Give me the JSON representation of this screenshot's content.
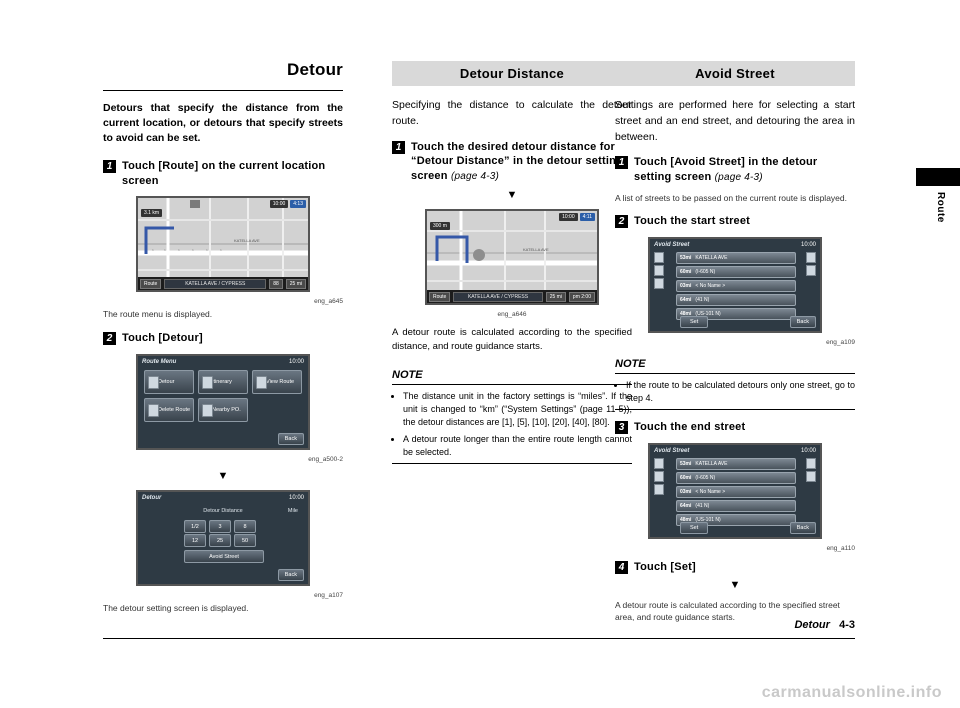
{
  "page": {
    "footer_title": "Detour",
    "footer_page": "4-3",
    "side_tab_label": "Route",
    "watermark": "carmanualsonline.info"
  },
  "col1": {
    "title": "Detour",
    "lead": "Detours that specify the distance from the current location, or detours that specify streets to avoid can be set.",
    "step1_num": "1",
    "step1_text": "Touch [Route] on the current location screen",
    "fig1_caption": "eng_a645",
    "after_fig1": "The route menu is displayed.",
    "step2_num": "2",
    "step2_text": "Touch [Detour]",
    "fig2_caption": "eng_a500-2",
    "fig3_caption": "eng_a107",
    "after_fig3": "The detour setting screen is displayed.",
    "map_shot": {
      "zoom_label": "3.1 km",
      "clock": "10:00",
      "eta_label": "4:13",
      "street": "KATELLA AVE / CYPRESS",
      "btn_route": "Route",
      "dist_value": "88",
      "dist_unit": "25 mi"
    },
    "route_menu": {
      "title": "Route Menu",
      "clock": "10:00",
      "buttons": [
        "Detour",
        "Itinerary",
        "View Route",
        "Delete Route",
        "Nearby PO."
      ],
      "back": "Back"
    },
    "detour_screen": {
      "title": "Detour",
      "clock": "10:00",
      "heading": "Detour Distance",
      "unit": "Mile",
      "row1": [
        "1/2",
        "3",
        "8"
      ],
      "row2": [
        "12",
        "25",
        "50"
      ],
      "avoid_street": "Avoid Street",
      "back": "Back"
    }
  },
  "col2": {
    "band": "Detour Distance",
    "intro": "Specifying the distance to calculate the detour route.",
    "step1_num": "1",
    "step1_text": "Touch the desired detour distance for “Detour Distance” in the detour setting screen",
    "step1_ref": "(page 4-3)",
    "fig_caption": "eng_a646",
    "after_fig": "A detour route is calculated according to the specified distance, and route guidance starts.",
    "note_label": "NOTE",
    "notes": [
      "The distance unit in the factory settings is “miles”. If the unit is changed to “km” (“System Settings” (page 11-5)), the detour distances are [1], [5], [10], [20], [40], [80].",
      "A detour route longer than the entire route length cannot be selected."
    ],
    "map_shot": {
      "zoom_label": "300 m",
      "clock": "10:00",
      "eta_label": "4:11",
      "street": "KATELLA AVE / CYPRESS",
      "btn_route": "Route",
      "dist_value": "25 mi",
      "dist_unit": "pm  2:00"
    }
  },
  "col3": {
    "band": "Avoid Street",
    "intro": "Settings are performed here for selecting a start street and an end street, and detouring the area in between.",
    "step1_num": "1",
    "step1_text": "Touch [Avoid Street] in the detour setting screen",
    "step1_ref": "(page 4-3)",
    "after_step1": "A list of streets to be passed on the current route is displayed.",
    "step2_num": "2",
    "step2_text": "Touch the start street",
    "fig1_caption": "eng_a109",
    "note_label": "NOTE",
    "notes": [
      "If the route to be calculated detours only one street, go to step 4."
    ],
    "step3_num": "3",
    "step3_text": "Touch the end street",
    "fig2_caption": "eng_a110",
    "step4_num": "4",
    "step4_text": "Touch [Set]",
    "after_step4": "A detour route is calculated according to the specified street area, and route guidance starts.",
    "avoid_screen1": {
      "title": "Avoid Street",
      "clock": "10:00",
      "rows": [
        {
          "dist": "53mi",
          "name": "KATELLA AVE"
        },
        {
          "dist": "60mi",
          "name": "(I-605 N)"
        },
        {
          "dist": "03mi",
          "name": "< No Name >"
        },
        {
          "dist": "64mi",
          "name": "(41 N)"
        },
        {
          "dist": "48mi",
          "name": "(US-101 N)"
        }
      ],
      "set": "Set",
      "back": "Back"
    },
    "avoid_screen2": {
      "title": "Avoid Street",
      "clock": "10:00",
      "rows": [
        {
          "dist": "53mi",
          "name": "KATELLA AVE"
        },
        {
          "dist": "60mi",
          "name": "(I-605 N)"
        },
        {
          "dist": "03mi",
          "name": "< No Name >"
        },
        {
          "dist": "64mi",
          "name": "(41 N)"
        },
        {
          "dist": "48mi",
          "name": "(US-101 N)"
        }
      ],
      "set": "Set",
      "back": "Back"
    }
  }
}
